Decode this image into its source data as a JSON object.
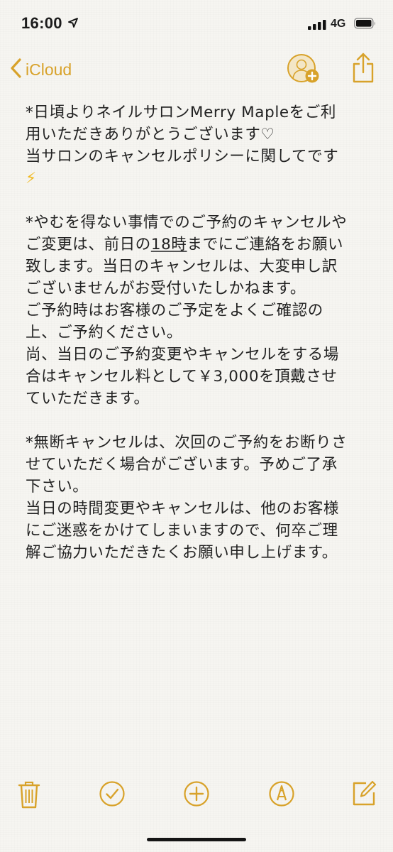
{
  "status_bar": {
    "time": "16:00",
    "network": "4G",
    "icons": [
      "location-arrow-icon",
      "signal-bars-icon",
      "battery-icon"
    ]
  },
  "nav": {
    "back_label": "iCloud",
    "icons": [
      "chevron-left-icon",
      "add-person-icon",
      "share-icon"
    ]
  },
  "note": {
    "lines": [
      "*日頃よりネイルサロンMerry Mapleをご利",
      "用いただきありがとうございます♡",
      "当サロンのキャンセルポリシーに関してです",
      "⚡",
      "",
      "*やむを得ない事情でのご予約のキャンセルや",
      "ご変更は、前日の18時までにご連絡をお願い",
      "致します。当日のキャンセルは、大変申し訳",
      "ございませんがお受付いたしかねます。",
      "ご予約時はお客様のご予定をよくご確認の",
      "上、ご予約ください。",
      "尚、当日のご予約変更やキャンセルをする場",
      "合はキャンセル料として￥3,000を頂戴させ",
      "ていただきます。",
      "",
      "*無断キャンセルは、次回のご予約をお断りさ",
      "せていただく場合がございます。予めご了承",
      "下さい。",
      "当日の時間変更やキャンセルは、他のお客様",
      "にご迷惑をかけてしまいますので、何卒ご理",
      "解ご協力いただきたくお願い申し上げます。"
    ]
  },
  "toolbar": {
    "icons": [
      "trash-icon",
      "checklist-icon",
      "add-icon",
      "markup-pen-icon",
      "compose-icon"
    ]
  },
  "colors": {
    "accent": "#d8a22a",
    "background": "#f6f5f1",
    "text": "#222222"
  }
}
